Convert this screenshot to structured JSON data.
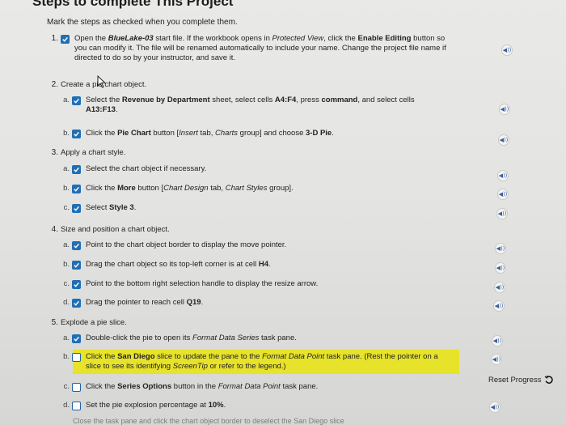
{
  "header": {
    "title": "Steps to complete This Project",
    "instructions": "Mark the steps as checked when you complete them."
  },
  "steps": [
    {
      "num": "1.",
      "line1_a": "Open the ",
      "file": "BlueLake-03",
      "line1_b": " start file. If the workbook opens in ",
      "view": "Protected View",
      "line1_c": ", click the ",
      "btn": "Enable Editing",
      "line1_d": " button so",
      "line2": "you can modify it. The file will be renamed automatically to include your name. Change the project file name if",
      "line3": "directed to do so by your instructor, and save it."
    },
    {
      "num": "2.",
      "label": "Create a pie chart object."
    },
    {
      "num": "3.",
      "label": "Apply a chart style."
    },
    {
      "num": "4.",
      "label": "Size and position a chart object."
    },
    {
      "num": "5.",
      "label": "Explode a pie slice."
    }
  ],
  "substeps": {
    "2a_l1_a": "Select the ",
    "2a_l1_b": "Revenue by Department",
    "2a_l1_c": " sheet, select cells ",
    "2a_l1_d": "A4:F4",
    "2a_l1_e": ", press ",
    "2a_l1_f": "command",
    "2a_l1_g": ", and select cells",
    "2a_l2": "A13:F13",
    "2b_a": "Click the ",
    "2b_b": "Pie Chart",
    "2b_c": " button [",
    "2b_d": "Insert",
    "2b_e": " tab, ",
    "2b_f": "Charts",
    "2b_g": " group] and choose ",
    "2b_h": "3-D Pie",
    "3a": "Select the chart object if necessary.",
    "3b_a": "Click the ",
    "3b_b": "More",
    "3b_c": " button [",
    "3b_d": "Chart Design",
    "3b_e": " tab, ",
    "3b_f": "Chart Styles",
    "3b_g": " group].",
    "3c_a": "Select ",
    "3c_b": "Style 3",
    "4a": "Point to the chart object border to display the move pointer.",
    "4b_a": "Drag the chart object so its top-left corner is at cell ",
    "4b_b": "H4",
    "4c": "Point to the bottom right selection handle to display the resize arrow.",
    "4d_a": "Drag the pointer to reach cell ",
    "4d_b": "Q19",
    "5a_a": "Double-click the pie to open its ",
    "5a_b": "Format Data Series",
    "5a_c": " task pane.",
    "5b_l1_a": "Click the ",
    "5b_l1_b": "San Diego",
    "5b_l1_c": " slice to update the pane to the ",
    "5b_l1_d": "Format Data Point",
    "5b_l1_e": " task pane. (Rest the pointer on a",
    "5b_l2_a": "slice to see its identifying ",
    "5b_l2_b": "ScreenTip",
    "5b_l2_c": " or refer to the legend.)",
    "5c_a": "Click the ",
    "5c_b": "Series Options",
    "5c_c": " button in the ",
    "5c_d": "Format Data Point",
    "5c_e": " task pane.",
    "5d_a": "Set the pie explosion percentage at ",
    "5d_b": "10%",
    "5e": "Close the task pane and click the chart object border to deselect the San Diego slice"
  },
  "letters": {
    "a": "a.",
    "b": "b.",
    "c": "c.",
    "d": "d."
  },
  "audio_label": "◀))",
  "reset_label": "Reset Progress"
}
